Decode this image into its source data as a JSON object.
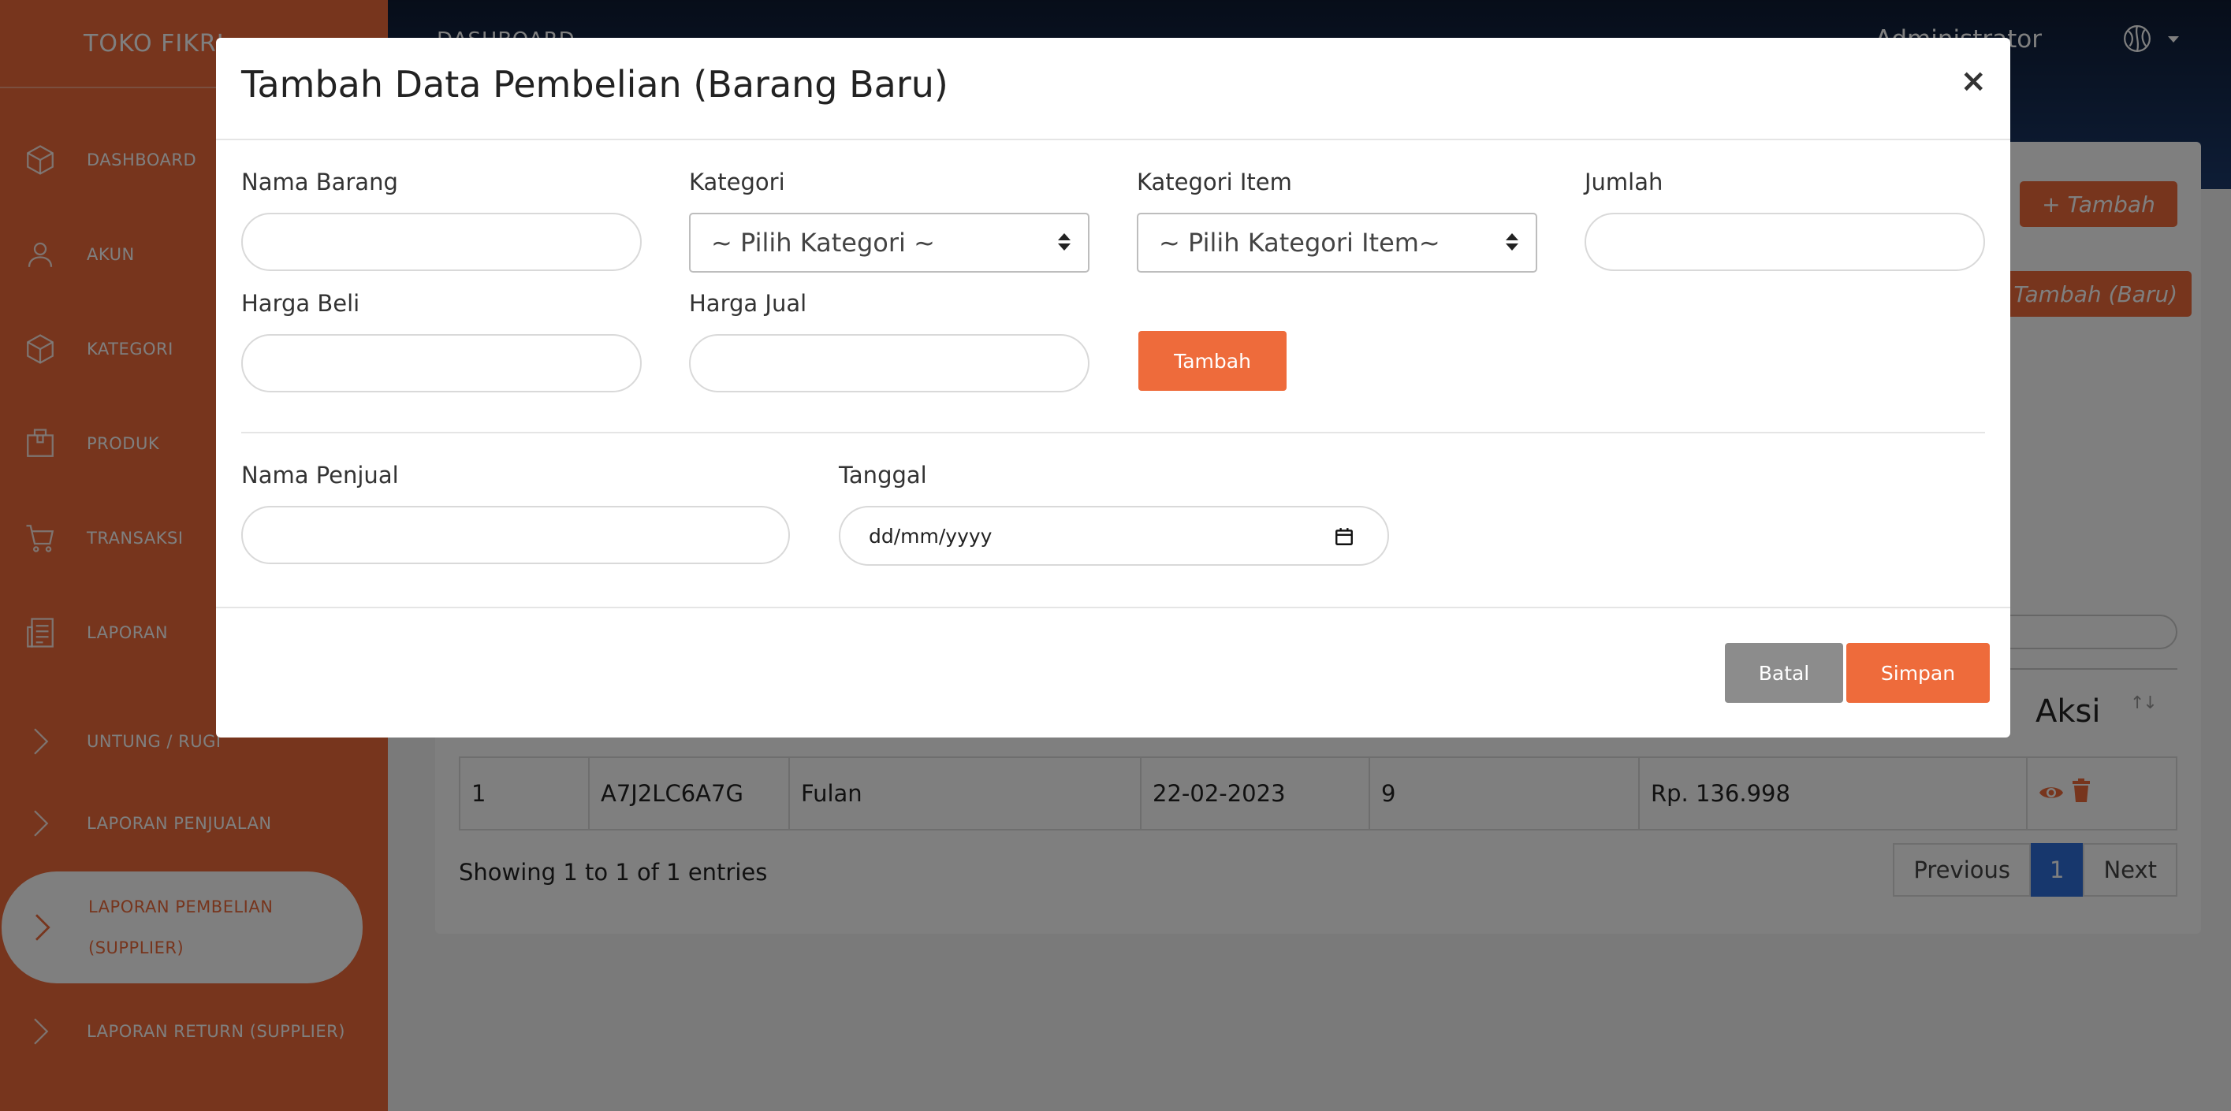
{
  "sidebar": {
    "brand": "TOKO FIKRI",
    "items": [
      {
        "label": "DASHBOARD",
        "icon": "box-icon"
      },
      {
        "label": "AKUN",
        "icon": "user-icon"
      },
      {
        "label": "KATEGORI",
        "icon": "box-icon"
      },
      {
        "label": "PRODUK",
        "icon": "package-icon"
      },
      {
        "label": "TRANSAKSI",
        "icon": "cart-icon"
      },
      {
        "label": "LAPORAN",
        "icon": "report-icon"
      },
      {
        "label": "UNTUNG / RUGI",
        "icon": "chevron-right-icon"
      },
      {
        "label": "LAPORAN PENJUALAN",
        "icon": "chevron-right-icon"
      },
      {
        "label": "LAPORAN PEMBELIAN (SUPPLIER)",
        "icon": "chevron-right-icon",
        "active": true
      },
      {
        "label": "LAPORAN RETURN (SUPPLIER)",
        "icon": "chevron-right-icon"
      }
    ]
  },
  "topbar": {
    "breadcrumb": "DASHBOARD",
    "user_name": "Administrator"
  },
  "main": {
    "tambah_button": "+ Tambah",
    "tambah_baru_button": "+ Tambah (Baru)",
    "table": {
      "header_aksi": "Aksi",
      "rows": [
        {
          "no": "1",
          "kode": "A7J2LC6A7G",
          "nama": "Fulan",
          "tanggal": "22-02-2023",
          "jumlah": "9",
          "total": "Rp. 136.998"
        }
      ]
    },
    "showing": "Showing 1 to 1 of 1 entries",
    "pagination": {
      "previous": "Previous",
      "current": "1",
      "next": "Next"
    }
  },
  "modal": {
    "title": "Tambah Data Pembelian (Barang Baru)",
    "close": "×",
    "fields": {
      "nama_barang": {
        "label": "Nama Barang",
        "value": ""
      },
      "kategori": {
        "label": "Kategori",
        "selected": "~ Pilih Kategori ~"
      },
      "kategori_item": {
        "label": "Kategori Item",
        "selected": "~ Pilih Kategori Item~"
      },
      "jumlah": {
        "label": "Jumlah",
        "value": ""
      },
      "harga_beli": {
        "label": "Harga Beli",
        "value": ""
      },
      "harga_jual": {
        "label": "Harga Jual",
        "value": ""
      },
      "nama_penjual": {
        "label": "Nama Penjual",
        "value": ""
      },
      "tanggal": {
        "label": "Tanggal",
        "placeholder": "dd/mm/yyyy"
      }
    },
    "tambah_button": "Tambah",
    "batal_button": "Batal",
    "simpan_button": "Simpan"
  },
  "colors": {
    "accent": "#ee6b3b",
    "topbar": "#1c3a6c",
    "pagination_active": "#2f6fdb",
    "batal": "#8c8c8c"
  }
}
